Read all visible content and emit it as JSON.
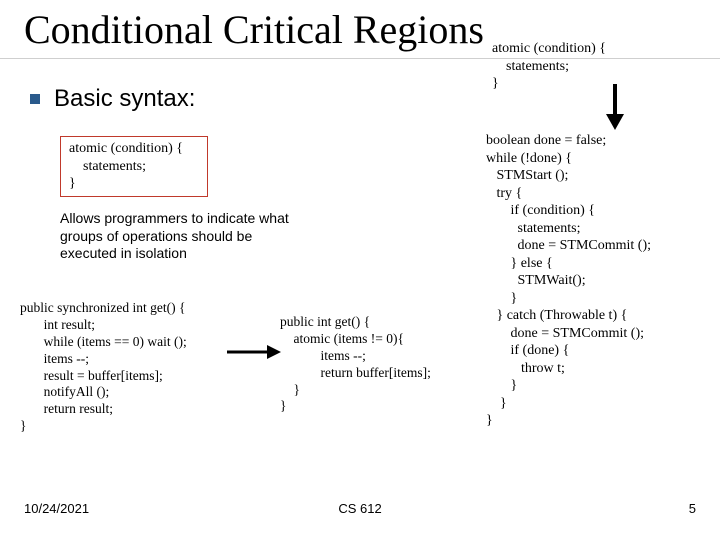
{
  "title": "Conditional Critical Regions",
  "bullet": "Basic syntax:",
  "syntax_box": "atomic (condition) {\n    statements;\n}",
  "explain": "Allows programmers to indicate what groups of operations should be executed in isolation",
  "code_left": "public synchronized int get() {\n       int result;\n       while (items == 0) wait ();\n       items --;\n       result = buffer[items];\n       notifyAll ();\n       return result;\n}",
  "code_mid": "public int get() {\n    atomic (items != 0){\n            items --;\n            return buffer[items];\n    }\n}",
  "code_top_right": "atomic (condition) {\n    statements;\n}",
  "code_right": "boolean done = false;\nwhile (!done) {\n   STMStart ();\n   try {\n       if (condition) {\n         statements;\n         done = STMCommit ();\n       } else {\n         STMWait();\n       }\n   } catch (Throwable t) {\n       done = STMCommit ();\n       if (done) {\n          throw t;\n       }\n    }\n}",
  "footer": {
    "date": "10/24/2021",
    "course": "CS 612",
    "page": "5"
  }
}
